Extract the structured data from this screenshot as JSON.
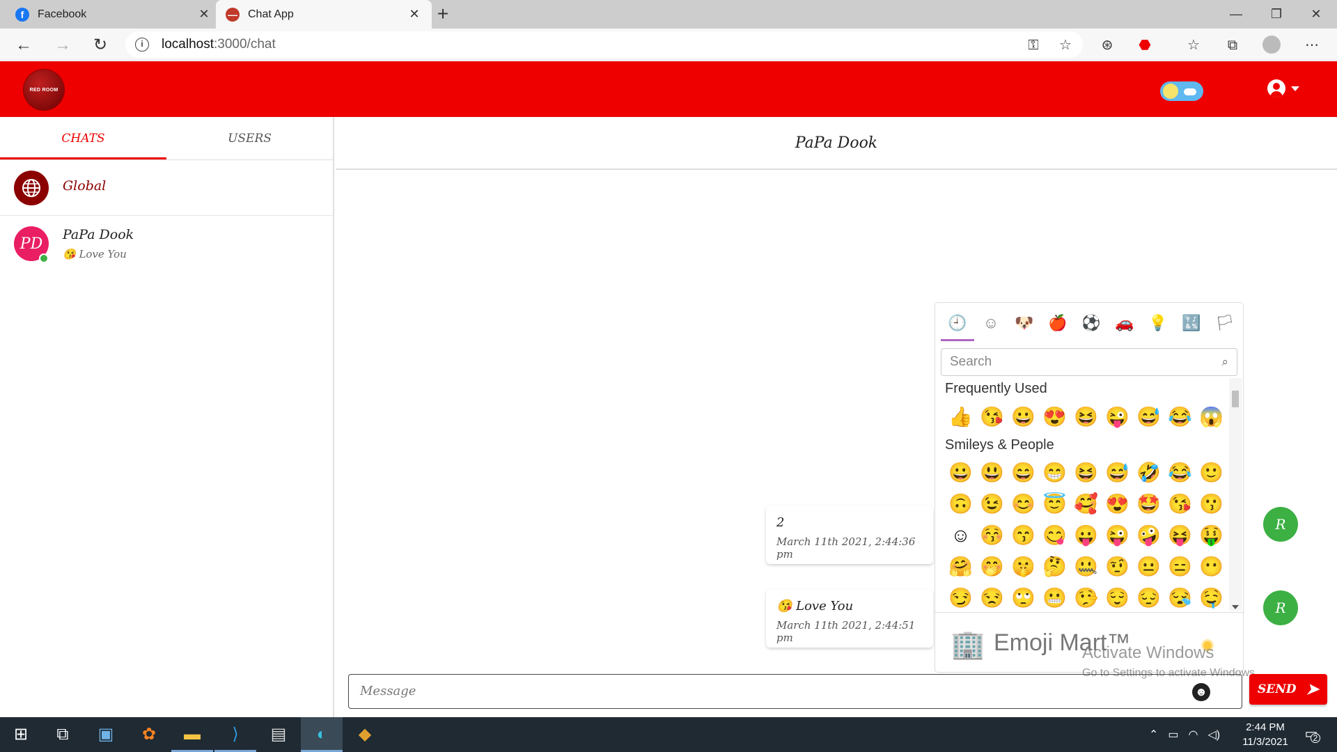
{
  "browser": {
    "tabs": [
      {
        "title": "Facebook",
        "close": "✕"
      },
      {
        "title": "Chat App",
        "close": "✕"
      }
    ],
    "new_tab": "+",
    "window_controls": {
      "minimize": "—",
      "maximize": "❐",
      "close": "✕"
    },
    "url_host": "localhost",
    "url_path": ":3000/chat"
  },
  "app": {
    "logo_text": "RED ROOM",
    "colors": {
      "primary": "#ee0000",
      "online": "#3cb043",
      "avatar_pd": "#e91e63",
      "avatar_global": "#8b0000"
    }
  },
  "sidebar": {
    "tabs": [
      "CHATS",
      "USERS"
    ],
    "chats": [
      {
        "name": "Global",
        "icon": "globe-icon"
      },
      {
        "name": "PaPa Dook",
        "initials": "PD",
        "last_message": "😘 Love You"
      }
    ]
  },
  "chat": {
    "title": "PaPa Dook",
    "messages": [
      {
        "text": "2",
        "date": "March 11th 2021, 2:44:36 pm",
        "avatar": "R"
      },
      {
        "text": "😘 Love You",
        "date": "March 11th 2021, 2:44:51 pm",
        "avatar": "R"
      }
    ]
  },
  "emoji_picker": {
    "categories": [
      "🕘",
      "☺",
      "🐶",
      "🍎",
      "⚽",
      "🚗",
      "💡",
      "🔣",
      "🏳"
    ],
    "search_placeholder": "Search",
    "sections": [
      {
        "title": "Frequently Used",
        "rows": [
          [
            "👍",
            "😘",
            "😀",
            "😍",
            "😆",
            "😜",
            "😅",
            "😂",
            "😱"
          ]
        ]
      },
      {
        "title": "Smileys & People",
        "rows": [
          [
            "😀",
            "😃",
            "😄",
            "😁",
            "😆",
            "😅",
            "🤣",
            "😂",
            "🙂"
          ],
          [
            "🙃",
            "😉",
            "😊",
            "😇",
            "🥰",
            "😍",
            "🤩",
            "😘",
            "😗"
          ],
          [
            "☺",
            "😚",
            "😙",
            "😋",
            "😛",
            "😜",
            "🤪",
            "😝",
            "🤑"
          ],
          [
            "🤗",
            "🤭",
            "🤫",
            "🤔",
            "🤐",
            "🤨",
            "😐",
            "😑",
            "😶"
          ],
          [
            "😏",
            "😒",
            "🙄",
            "😬",
            "🤥",
            "😌",
            "😔",
            "😪",
            "🤤"
          ]
        ]
      }
    ],
    "preview": {
      "emoji": "🏢",
      "label": "Emoji Mart™"
    }
  },
  "watermark": {
    "line1": "Activate Windows",
    "line2": "Go to Settings to activate Windows."
  },
  "composer": {
    "placeholder": "Message",
    "send_label": "SEND"
  },
  "taskbar": {
    "time": "2:44 PM",
    "date": "11/3/2021",
    "notifications": "2"
  }
}
